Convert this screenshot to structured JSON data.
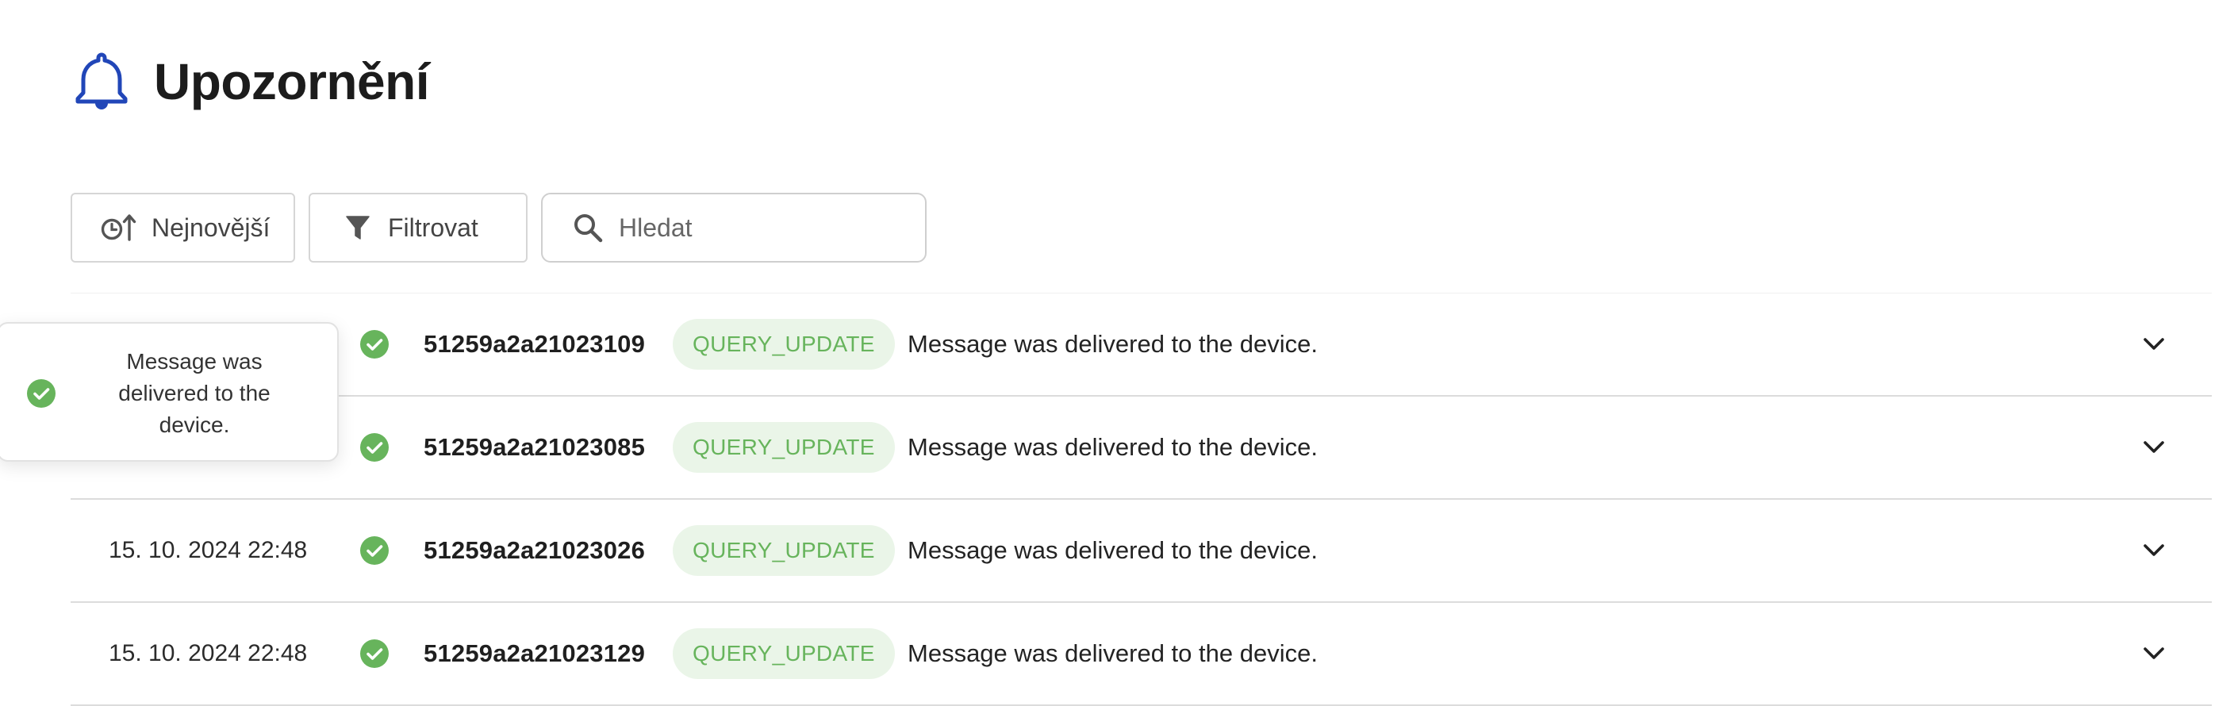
{
  "header": {
    "title": "Upozornění",
    "icon": "bell-icon",
    "icon_color": "#2146b8"
  },
  "toolbar": {
    "sort_label": "Nejnovější",
    "sort_icon": "clock-sort-icon",
    "filter_label": "Filtrovat",
    "filter_icon": "filter-icon",
    "search_placeholder": "Hledat",
    "search_value": "",
    "search_icon": "search-icon"
  },
  "notifications": [
    {
      "date": "",
      "status": "delivered",
      "status_icon": "check-circle-icon",
      "id": "51259a2a21023109",
      "type": "QUERY_UPDATE",
      "message": "Message was delivered to the device."
    },
    {
      "date": "",
      "status": "delivered",
      "status_icon": "check-circle-icon",
      "id": "51259a2a21023085",
      "type": "QUERY_UPDATE",
      "message": "Message was delivered to the device."
    },
    {
      "date": "15. 10. 2024 22:48",
      "status": "delivered",
      "status_icon": "check-circle-icon",
      "id": "51259a2a21023026",
      "type": "QUERY_UPDATE",
      "message": "Message was delivered to the device."
    },
    {
      "date": "15. 10. 2024 22:48",
      "status": "delivered",
      "status_icon": "check-circle-icon",
      "id": "51259a2a21023129",
      "type": "QUERY_UPDATE",
      "message": "Message was delivered to the device."
    }
  ],
  "toast": {
    "text": "Message was delivered to the device.",
    "icon": "check-circle-icon"
  },
  "colors": {
    "success": "#67b45c",
    "badge_bg": "#eaf5e8",
    "accent": "#2146b8",
    "border": "#d6d6d6"
  }
}
